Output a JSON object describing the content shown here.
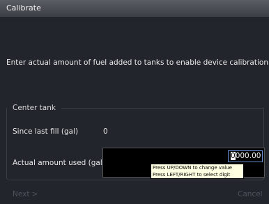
{
  "window": {
    "title": "Calibrate"
  },
  "instruction": "Enter actual amount of fuel added to tanks to enable device calibration.",
  "group": {
    "label": "Center tank",
    "since_last_fill_label": "Since last fill (gal)",
    "since_last_fill_value": "0",
    "actual_used_label": "Actual amount used (gal)",
    "actual_used_value_cursor": "0",
    "actual_used_value_rest": "000.00"
  },
  "tooltip": {
    "line1": "Press UP/DOWN to change value",
    "line2": "Press LEFT/RIGHT to select digit"
  },
  "buttons": {
    "next_label": "Next >",
    "cancel_label": "Cancel"
  }
}
